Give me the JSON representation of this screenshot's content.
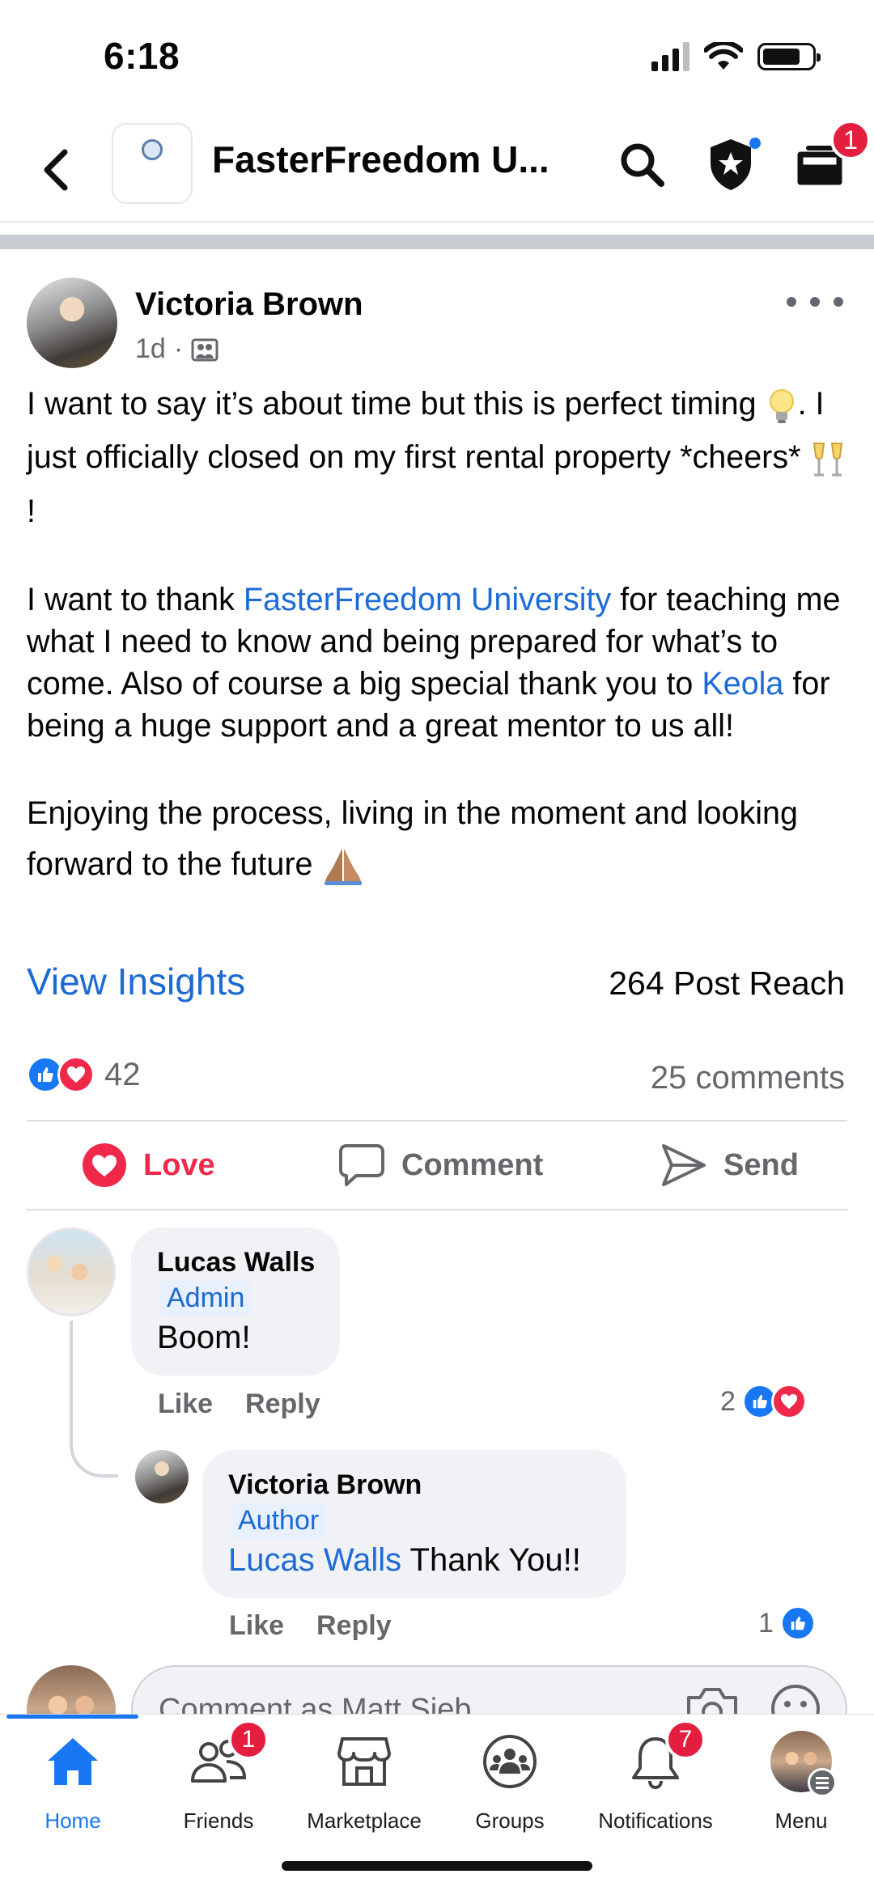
{
  "status_bar": {
    "time": "6:18"
  },
  "header": {
    "title": "FasterFreedom U...",
    "cart_badge": "1"
  },
  "post": {
    "author": "Victoria Brown",
    "time": "1d",
    "body": {
      "p1": "I want to say it’s about time but this is perfect timing",
      "p1b": ". I just officially closed on my first rental property *cheers*",
      "p1c": "!",
      "p2_a": "I want to thank ",
      "p2_link1": "FasterFreedom University",
      "p2_b": " for teaching me what I need to know and being prepared for what’s to come. Also of course a big special thank you to ",
      "p2_link2": "Keola",
      "p2_c": " for being a huge support and a great mentor to us all!",
      "p3": "Enjoying the process, living in the moment and looking forward to the future"
    },
    "view_insights": "View Insights",
    "post_reach": "264 Post Reach",
    "reaction_count": "42",
    "comments_count": "25 comments",
    "actions": {
      "love": "Love",
      "comment": "Comment",
      "send": "Send"
    }
  },
  "comments": [
    {
      "name": "Lucas Walls",
      "role": "Admin",
      "text": "Boom!",
      "like": "Like",
      "reply": "Reply",
      "reaction_count": "2"
    },
    {
      "name": "Victoria Brown",
      "role": "Author",
      "mention": "Lucas Walls",
      "text": " Thank You!!",
      "like": "Like",
      "reply": "Reply",
      "reaction_count": "1"
    }
  ],
  "comment_input": {
    "placeholder": "Comment as Matt Sieb"
  },
  "nav": {
    "home": "Home",
    "friends": "Friends",
    "friends_badge": "1",
    "marketplace": "Marketplace",
    "groups": "Groups",
    "notifications": "Notifications",
    "notifications_badge": "7",
    "menu": "Menu"
  },
  "colors": {
    "accent": "#1877f2",
    "link": "#1b6ad3",
    "love": "#f0284a",
    "badge": "#e41e3f",
    "muted": "#65676b"
  },
  "icons": [
    "back-icon",
    "search-icon",
    "shield-star-icon",
    "cart-icon",
    "group-photo-icon",
    "more-icon",
    "lightbulb-emoji",
    "cheers-emoji",
    "pray-emoji",
    "like-reaction-icon",
    "love-reaction-icon",
    "comment-icon",
    "send-icon",
    "camera-icon",
    "smiley-icon",
    "home-icon",
    "friends-icon",
    "marketplace-icon",
    "groups-icon",
    "bell-icon"
  ]
}
